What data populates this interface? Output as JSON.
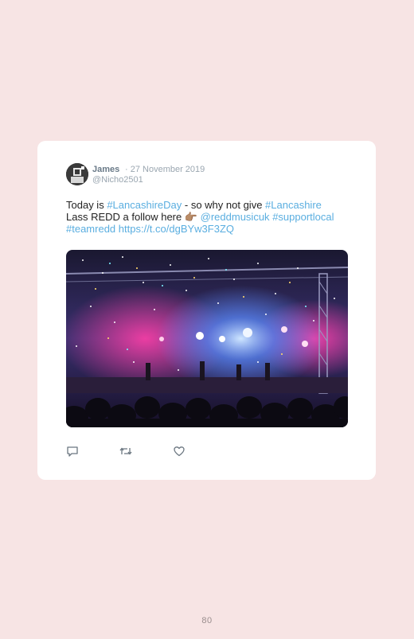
{
  "tweet": {
    "author_name": "James",
    "date": "· 27 November 2019",
    "handle": "@Nicho2501",
    "text": {
      "t1": "Today is ",
      "h1": "#LancashireDay",
      "t2": " - so why not give ",
      "h2": "#Lancashire",
      "t3": " Lass REDD a follow here ",
      "emoji": "👉🏽",
      "t4": " ",
      "m1": "@reddmusicuk",
      "t5": " ",
      "h3": "#supportlocal",
      "t6": " ",
      "h4": "#teamredd",
      "t7": " ",
      "url": "https://t.co/dgBYw3F3ZQ"
    },
    "actions": [
      "reply-icon",
      "retweet-icon",
      "like-icon"
    ]
  },
  "page_number": "80",
  "colors": {
    "background": "#f7e4e4",
    "card": "#ffffff",
    "link": "#5aaee0",
    "name": "#6a7a88",
    "meta": "#9aa6b0"
  }
}
